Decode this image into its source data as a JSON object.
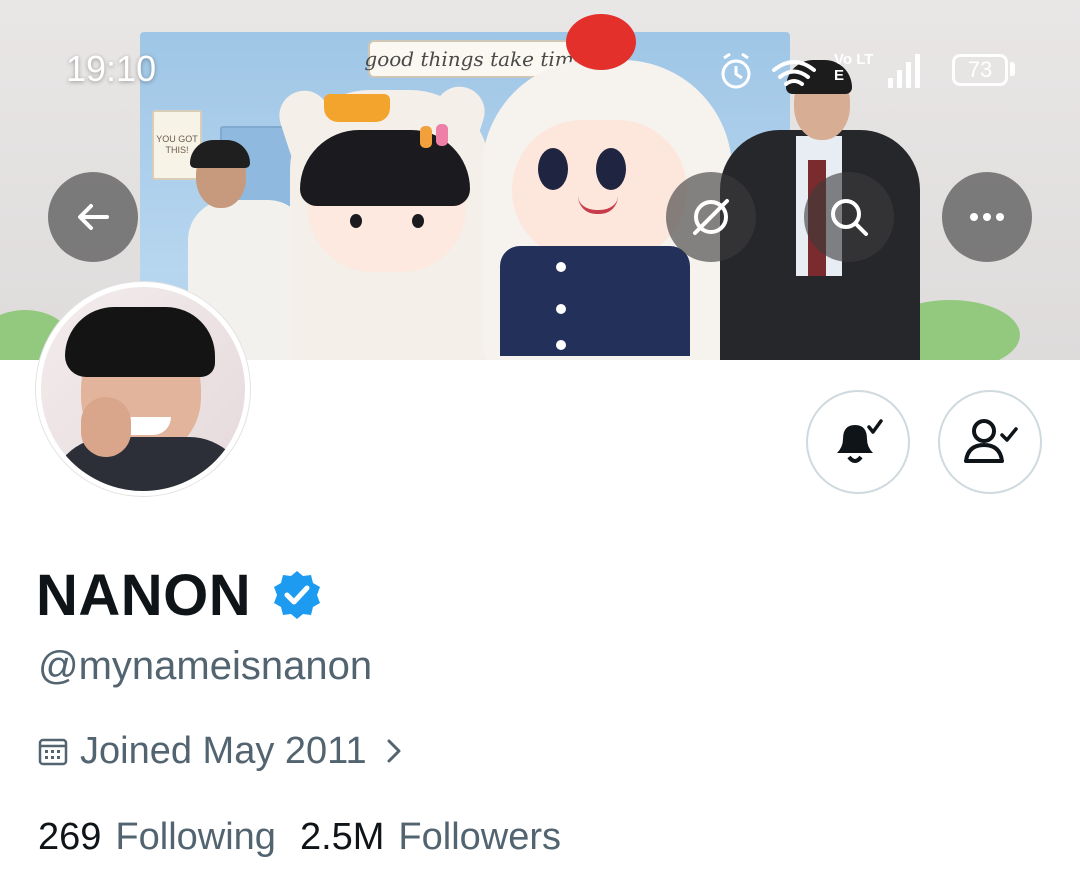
{
  "status_bar": {
    "time": "19:10",
    "network_label": "Vo LTE",
    "battery": "73"
  },
  "banner": {
    "sign_text": "good things take time",
    "poster_text": "YOU GOT THIS!",
    "icons": [
      "back-arrow-icon",
      "grok-icon",
      "search-icon",
      "more-icon"
    ]
  },
  "profile": {
    "display_name": "NANON",
    "verified": true,
    "handle": "@mynameisnanon",
    "joined": "Joined May 2011",
    "following_count": "269",
    "following_label": "Following",
    "followers_count": "2.5M",
    "followers_label": "Followers"
  },
  "actions": {
    "notifications_icon": "bell-check-icon",
    "following_icon": "person-check-icon"
  },
  "colors": {
    "text_primary": "#0f1419",
    "text_secondary": "#536471",
    "verified_blue": "#1d9bf0",
    "button_border": "#cfd9de"
  }
}
